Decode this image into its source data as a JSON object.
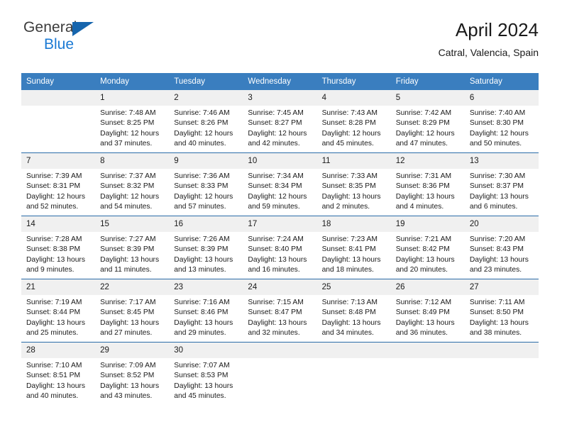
{
  "brand": {
    "name_top": "General",
    "name_bottom": "Blue",
    "triangle_color": "#1665ad",
    "blue_color": "#1b7ad4"
  },
  "header": {
    "title": "April 2024",
    "subtitle": "Catral, Valencia, Spain",
    "accent_color": "#3a7ebf",
    "separator_color": "#2b6ca8",
    "daynum_bg": "#f0f0f0"
  },
  "calendar": {
    "weekdays": [
      "Sunday",
      "Monday",
      "Tuesday",
      "Wednesday",
      "Thursday",
      "Friday",
      "Saturday"
    ],
    "weeks": [
      [
        {
          "day": "",
          "sunrise": "",
          "sunset": "",
          "daylight1": "",
          "daylight2": ""
        },
        {
          "day": "1",
          "sunrise": "Sunrise: 7:48 AM",
          "sunset": "Sunset: 8:25 PM",
          "daylight1": "Daylight: 12 hours",
          "daylight2": "and 37 minutes."
        },
        {
          "day": "2",
          "sunrise": "Sunrise: 7:46 AM",
          "sunset": "Sunset: 8:26 PM",
          "daylight1": "Daylight: 12 hours",
          "daylight2": "and 40 minutes."
        },
        {
          "day": "3",
          "sunrise": "Sunrise: 7:45 AM",
          "sunset": "Sunset: 8:27 PM",
          "daylight1": "Daylight: 12 hours",
          "daylight2": "and 42 minutes."
        },
        {
          "day": "4",
          "sunrise": "Sunrise: 7:43 AM",
          "sunset": "Sunset: 8:28 PM",
          "daylight1": "Daylight: 12 hours",
          "daylight2": "and 45 minutes."
        },
        {
          "day": "5",
          "sunrise": "Sunrise: 7:42 AM",
          "sunset": "Sunset: 8:29 PM",
          "daylight1": "Daylight: 12 hours",
          "daylight2": "and 47 minutes."
        },
        {
          "day": "6",
          "sunrise": "Sunrise: 7:40 AM",
          "sunset": "Sunset: 8:30 PM",
          "daylight1": "Daylight: 12 hours",
          "daylight2": "and 50 minutes."
        }
      ],
      [
        {
          "day": "7",
          "sunrise": "Sunrise: 7:39 AM",
          "sunset": "Sunset: 8:31 PM",
          "daylight1": "Daylight: 12 hours",
          "daylight2": "and 52 minutes."
        },
        {
          "day": "8",
          "sunrise": "Sunrise: 7:37 AM",
          "sunset": "Sunset: 8:32 PM",
          "daylight1": "Daylight: 12 hours",
          "daylight2": "and 54 minutes."
        },
        {
          "day": "9",
          "sunrise": "Sunrise: 7:36 AM",
          "sunset": "Sunset: 8:33 PM",
          "daylight1": "Daylight: 12 hours",
          "daylight2": "and 57 minutes."
        },
        {
          "day": "10",
          "sunrise": "Sunrise: 7:34 AM",
          "sunset": "Sunset: 8:34 PM",
          "daylight1": "Daylight: 12 hours",
          "daylight2": "and 59 minutes."
        },
        {
          "day": "11",
          "sunrise": "Sunrise: 7:33 AM",
          "sunset": "Sunset: 8:35 PM",
          "daylight1": "Daylight: 13 hours",
          "daylight2": "and 2 minutes."
        },
        {
          "day": "12",
          "sunrise": "Sunrise: 7:31 AM",
          "sunset": "Sunset: 8:36 PM",
          "daylight1": "Daylight: 13 hours",
          "daylight2": "and 4 minutes."
        },
        {
          "day": "13",
          "sunrise": "Sunrise: 7:30 AM",
          "sunset": "Sunset: 8:37 PM",
          "daylight1": "Daylight: 13 hours",
          "daylight2": "and 6 minutes."
        }
      ],
      [
        {
          "day": "14",
          "sunrise": "Sunrise: 7:28 AM",
          "sunset": "Sunset: 8:38 PM",
          "daylight1": "Daylight: 13 hours",
          "daylight2": "and 9 minutes."
        },
        {
          "day": "15",
          "sunrise": "Sunrise: 7:27 AM",
          "sunset": "Sunset: 8:39 PM",
          "daylight1": "Daylight: 13 hours",
          "daylight2": "and 11 minutes."
        },
        {
          "day": "16",
          "sunrise": "Sunrise: 7:26 AM",
          "sunset": "Sunset: 8:39 PM",
          "daylight1": "Daylight: 13 hours",
          "daylight2": "and 13 minutes."
        },
        {
          "day": "17",
          "sunrise": "Sunrise: 7:24 AM",
          "sunset": "Sunset: 8:40 PM",
          "daylight1": "Daylight: 13 hours",
          "daylight2": "and 16 minutes."
        },
        {
          "day": "18",
          "sunrise": "Sunrise: 7:23 AM",
          "sunset": "Sunset: 8:41 PM",
          "daylight1": "Daylight: 13 hours",
          "daylight2": "and 18 minutes."
        },
        {
          "day": "19",
          "sunrise": "Sunrise: 7:21 AM",
          "sunset": "Sunset: 8:42 PM",
          "daylight1": "Daylight: 13 hours",
          "daylight2": "and 20 minutes."
        },
        {
          "day": "20",
          "sunrise": "Sunrise: 7:20 AM",
          "sunset": "Sunset: 8:43 PM",
          "daylight1": "Daylight: 13 hours",
          "daylight2": "and 23 minutes."
        }
      ],
      [
        {
          "day": "21",
          "sunrise": "Sunrise: 7:19 AM",
          "sunset": "Sunset: 8:44 PM",
          "daylight1": "Daylight: 13 hours",
          "daylight2": "and 25 minutes."
        },
        {
          "day": "22",
          "sunrise": "Sunrise: 7:17 AM",
          "sunset": "Sunset: 8:45 PM",
          "daylight1": "Daylight: 13 hours",
          "daylight2": "and 27 minutes."
        },
        {
          "day": "23",
          "sunrise": "Sunrise: 7:16 AM",
          "sunset": "Sunset: 8:46 PM",
          "daylight1": "Daylight: 13 hours",
          "daylight2": "and 29 minutes."
        },
        {
          "day": "24",
          "sunrise": "Sunrise: 7:15 AM",
          "sunset": "Sunset: 8:47 PM",
          "daylight1": "Daylight: 13 hours",
          "daylight2": "and 32 minutes."
        },
        {
          "day": "25",
          "sunrise": "Sunrise: 7:13 AM",
          "sunset": "Sunset: 8:48 PM",
          "daylight1": "Daylight: 13 hours",
          "daylight2": "and 34 minutes."
        },
        {
          "day": "26",
          "sunrise": "Sunrise: 7:12 AM",
          "sunset": "Sunset: 8:49 PM",
          "daylight1": "Daylight: 13 hours",
          "daylight2": "and 36 minutes."
        },
        {
          "day": "27",
          "sunrise": "Sunrise: 7:11 AM",
          "sunset": "Sunset: 8:50 PM",
          "daylight1": "Daylight: 13 hours",
          "daylight2": "and 38 minutes."
        }
      ],
      [
        {
          "day": "28",
          "sunrise": "Sunrise: 7:10 AM",
          "sunset": "Sunset: 8:51 PM",
          "daylight1": "Daylight: 13 hours",
          "daylight2": "and 40 minutes."
        },
        {
          "day": "29",
          "sunrise": "Sunrise: 7:09 AM",
          "sunset": "Sunset: 8:52 PM",
          "daylight1": "Daylight: 13 hours",
          "daylight2": "and 43 minutes."
        },
        {
          "day": "30",
          "sunrise": "Sunrise: 7:07 AM",
          "sunset": "Sunset: 8:53 PM",
          "daylight1": "Daylight: 13 hours",
          "daylight2": "and 45 minutes."
        },
        {
          "day": "",
          "sunrise": "",
          "sunset": "",
          "daylight1": "",
          "daylight2": ""
        },
        {
          "day": "",
          "sunrise": "",
          "sunset": "",
          "daylight1": "",
          "daylight2": ""
        },
        {
          "day": "",
          "sunrise": "",
          "sunset": "",
          "daylight1": "",
          "daylight2": ""
        },
        {
          "day": "",
          "sunrise": "",
          "sunset": "",
          "daylight1": "",
          "daylight2": ""
        }
      ]
    ]
  }
}
